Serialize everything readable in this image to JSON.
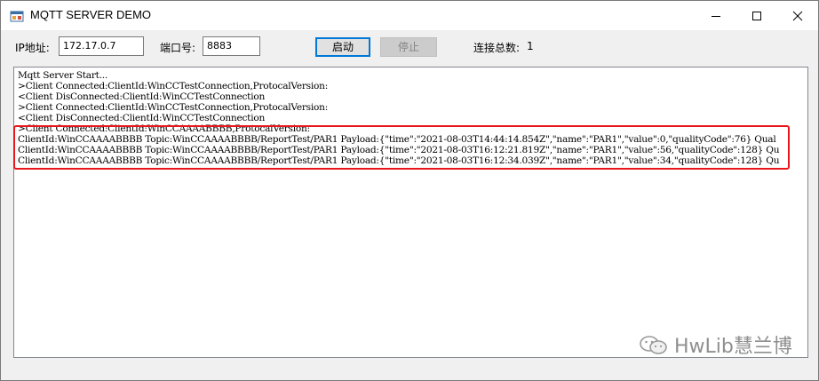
{
  "window": {
    "title": "MQTT SERVER DEMO"
  },
  "toolbar": {
    "ip_label": "IP地址:",
    "ip_value": "172.17.0.7",
    "port_label": "端口号:",
    "port_value": "8883",
    "start_label": "启动",
    "stop_label": "停止",
    "connections_label": "连接总数:",
    "connections_count": "1"
  },
  "log": {
    "lines": [
      "Mqtt Server Start...",
      ">Client Connected:ClientId:WinCCTestConnection,ProtocalVersion:",
      "<Client DisConnected:ClientId:WinCCTestConnection",
      ">Client Connected:ClientId:WinCCTestConnection,ProtocalVersion:",
      "<Client DisConnected:ClientId:WinCCTestConnection",
      ">Client Connected:ClientId:WinCCAAAABBBB,ProtocalVersion:",
      "ClientId:WinCCAAAABBBB Topic:WinCCAAAABBBB/ReportTest/PAR1 Payload:{\"time\":\"2021-08-03T14:44:14.854Z\",\"name\":\"PAR1\",\"value\":0,\"qualityCode\":76} Qual",
      "ClientId:WinCCAAAABBBB Topic:WinCCAAAABBBB/ReportTest/PAR1 Payload:{\"time\":\"2021-08-03T16:12:21.819Z\",\"name\":\"PAR1\",\"value\":56,\"qualityCode\":128} Qu",
      "ClientId:WinCCAAAABBBB Topic:WinCCAAAABBBB/ReportTest/PAR1 Payload:{\"time\":\"2021-08-03T16:12:34.039Z\",\"name\":\"PAR1\",\"value\":34,\"qualityCode\":128} Qu"
    ]
  },
  "watermark": {
    "text": "HwLib慧兰博"
  },
  "colors": {
    "highlight": "#e8161a",
    "focus_border": "#0078d7"
  },
  "icons": {
    "app": "app-window-icon",
    "minimize": "minimize-icon",
    "maximize": "maximize-icon",
    "close": "close-icon",
    "watermark": "wechat-icon"
  }
}
